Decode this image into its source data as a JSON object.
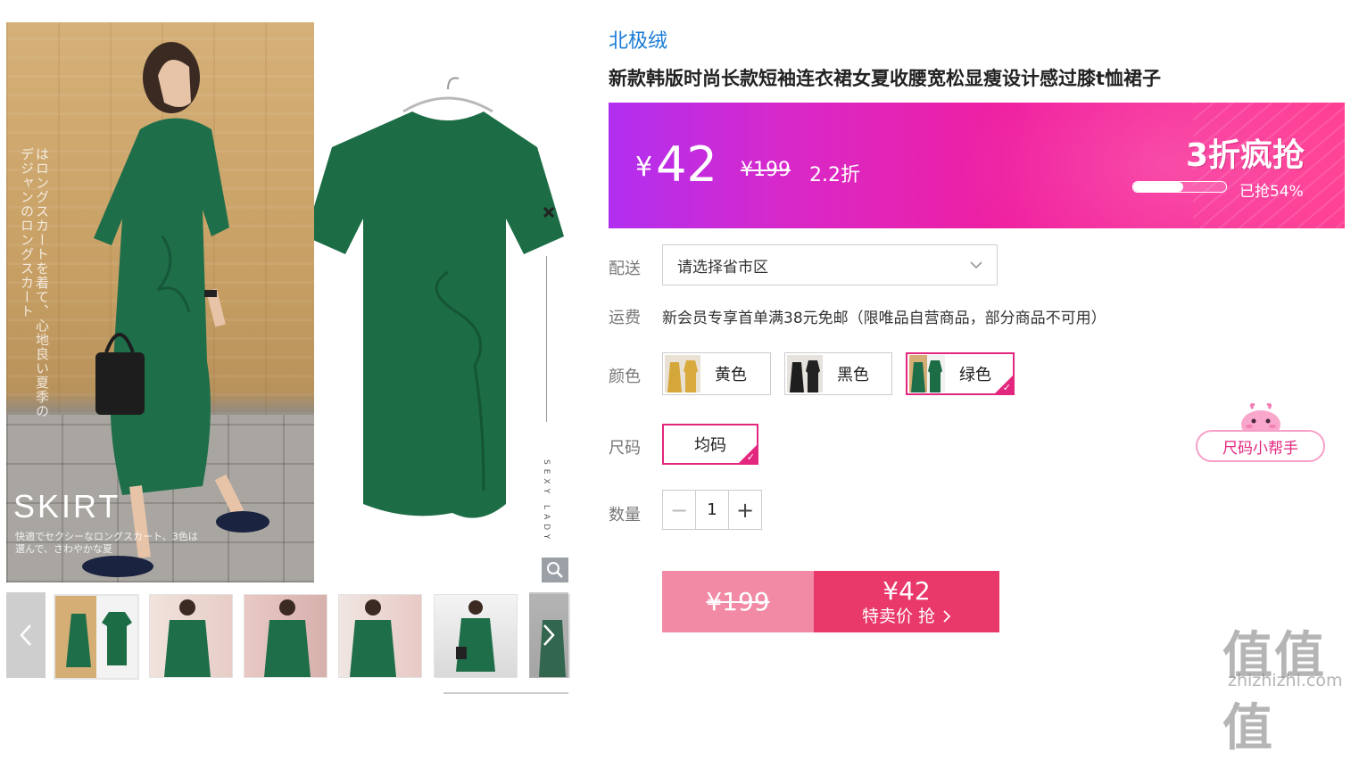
{
  "gallery": {
    "main_image": {
      "vertical_text": "はロングスカートを着て、心地良い夏季のデジャンのロングスカート",
      "skirt_title": "SKIRT",
      "skirt_subtitle": "快適でセクシーなロングスカート、3色は選んで、さわやかな夏",
      "side_text": "SEXY LADY"
    },
    "thumbnails": [
      "thumb-1",
      "thumb-2",
      "thumb-3",
      "thumb-4",
      "thumb-5",
      "thumb-6"
    ],
    "prev_icon": "chevron-left-icon",
    "next_icon": "chevron-right-icon",
    "zoom_icon": "magnifier-icon"
  },
  "product": {
    "brand": "北极绒",
    "title": "新款韩版时尚长款短袖连衣裙女夏收腰宽松显瘦设计感过膝t恤裙子"
  },
  "price_banner": {
    "currency": "¥",
    "price": "42",
    "original_price": "¥199",
    "discount": "2.2折",
    "promo_label": "3折疯抢",
    "progress_text": "已抢54%",
    "progress_value": 0.54,
    "gradient_colors": [
      "#b12ff0",
      "#f01f9f",
      "#ff3f93"
    ]
  },
  "delivery": {
    "label": "配送",
    "placeholder": "请选择省市区",
    "icon": "chevron-down-icon"
  },
  "shipping": {
    "label": "运费",
    "text": "新会员专享首单满38元免邮（限唯品自营商品，部分商品不可用）"
  },
  "colors": {
    "label": "颜色",
    "options": [
      {
        "name": "黄色",
        "selected": false
      },
      {
        "name": "黑色",
        "selected": false
      },
      {
        "name": "绿色",
        "selected": true
      }
    ]
  },
  "sizes": {
    "label": "尺码",
    "options": [
      {
        "name": "均码",
        "selected": true
      }
    ],
    "helper": "尺码小帮手"
  },
  "quantity": {
    "label": "数量",
    "value": "1",
    "minus": "−",
    "plus": "+"
  },
  "buy": {
    "original_price": "¥199",
    "price": "¥42",
    "action_label": "特卖价 抢",
    "action_icon": "chevron-right-icon"
  },
  "watermark": {
    "text": "值值值",
    "url": "zhizhizhi.com"
  },
  "colors_theme": {
    "accent": "#e3267e",
    "brand_blue": "#1a7bd6",
    "buy_button": "#e9386a",
    "buy_original": "#f28aa6"
  }
}
